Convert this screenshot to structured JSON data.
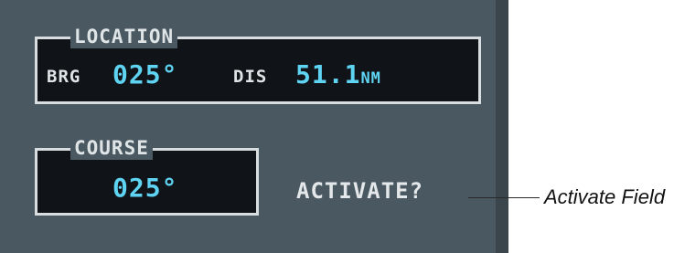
{
  "location": {
    "title": "LOCATION",
    "brg_label": "BRG",
    "brg_value": "025°",
    "dis_label": "DIS",
    "dis_value": "51.1",
    "dis_unit": "NM"
  },
  "course": {
    "title": "COURSE",
    "value": "025°"
  },
  "activate_label": "ACTIVATE?",
  "callout": "Activate Field",
  "colors": {
    "screen_bg": "#4a5961",
    "box_bg": "#101418",
    "label": "#dfe4e6",
    "value_cyan": "#5fd3f2"
  }
}
